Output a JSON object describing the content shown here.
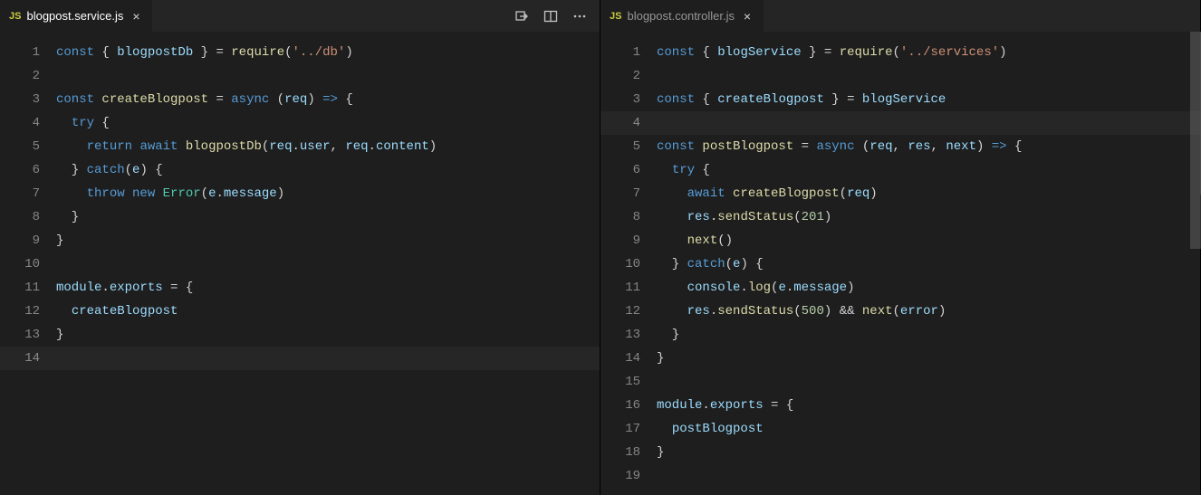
{
  "leftPane": {
    "tab": {
      "icon": "JS",
      "title": "blogpost.service.js",
      "active": true
    },
    "activeLine": 14,
    "lines": [
      {
        "n": 1,
        "tokens": [
          [
            "kw",
            "const"
          ],
          [
            "pun",
            " { "
          ],
          [
            "var",
            "blogpostDb"
          ],
          [
            "pun",
            " } "
          ],
          [
            "op",
            "="
          ],
          [
            "pun",
            " "
          ],
          [
            "fn",
            "require"
          ],
          [
            "pun",
            "("
          ],
          [
            "str",
            "'../db'"
          ],
          [
            "pun",
            ")"
          ]
        ]
      },
      {
        "n": 2,
        "tokens": []
      },
      {
        "n": 3,
        "tokens": [
          [
            "kw",
            "const"
          ],
          [
            "pun",
            " "
          ],
          [
            "fn",
            "createBlogpost"
          ],
          [
            "pun",
            " "
          ],
          [
            "op",
            "="
          ],
          [
            "pun",
            " "
          ],
          [
            "kw",
            "async"
          ],
          [
            "pun",
            " ("
          ],
          [
            "var",
            "req"
          ],
          [
            "pun",
            ") "
          ],
          [
            "arrow",
            "=>"
          ],
          [
            "pun",
            " {"
          ]
        ]
      },
      {
        "n": 4,
        "tokens": [
          [
            "pun",
            "  "
          ],
          [
            "kw",
            "try"
          ],
          [
            "pun",
            " {"
          ]
        ]
      },
      {
        "n": 5,
        "tokens": [
          [
            "pun",
            "    "
          ],
          [
            "kw",
            "return"
          ],
          [
            "pun",
            " "
          ],
          [
            "kw",
            "await"
          ],
          [
            "pun",
            " "
          ],
          [
            "fn",
            "blogpostDb"
          ],
          [
            "pun",
            "("
          ],
          [
            "var",
            "req"
          ],
          [
            "pun",
            "."
          ],
          [
            "var",
            "user"
          ],
          [
            "pun",
            ", "
          ],
          [
            "var",
            "req"
          ],
          [
            "pun",
            "."
          ],
          [
            "var",
            "content"
          ],
          [
            "pun",
            ")"
          ]
        ]
      },
      {
        "n": 6,
        "tokens": [
          [
            "pun",
            "  } "
          ],
          [
            "kw",
            "catch"
          ],
          [
            "pun",
            "("
          ],
          [
            "var",
            "e"
          ],
          [
            "pun",
            ") {"
          ]
        ]
      },
      {
        "n": 7,
        "tokens": [
          [
            "pun",
            "    "
          ],
          [
            "kw",
            "throw"
          ],
          [
            "pun",
            " "
          ],
          [
            "kw",
            "new"
          ],
          [
            "pun",
            " "
          ],
          [
            "cls",
            "Error"
          ],
          [
            "pun",
            "("
          ],
          [
            "var",
            "e"
          ],
          [
            "pun",
            "."
          ],
          [
            "var",
            "message"
          ],
          [
            "pun",
            ")"
          ]
        ]
      },
      {
        "n": 8,
        "tokens": [
          [
            "pun",
            "  }"
          ]
        ]
      },
      {
        "n": 9,
        "tokens": [
          [
            "pun",
            "}"
          ]
        ]
      },
      {
        "n": 10,
        "tokens": []
      },
      {
        "n": 11,
        "tokens": [
          [
            "var",
            "module"
          ],
          [
            "pun",
            "."
          ],
          [
            "var",
            "exports"
          ],
          [
            "pun",
            " "
          ],
          [
            "op",
            "="
          ],
          [
            "pun",
            " {"
          ]
        ]
      },
      {
        "n": 12,
        "tokens": [
          [
            "pun",
            "  "
          ],
          [
            "var",
            "createBlogpost"
          ]
        ]
      },
      {
        "n": 13,
        "tokens": [
          [
            "pun",
            "}"
          ]
        ]
      },
      {
        "n": 14,
        "tokens": []
      }
    ]
  },
  "rightPane": {
    "tab": {
      "icon": "JS",
      "title": "blogpost.controller.js",
      "active": false
    },
    "activeLine": 4,
    "lines": [
      {
        "n": 1,
        "tokens": [
          [
            "kw",
            "const"
          ],
          [
            "pun",
            " { "
          ],
          [
            "var",
            "blogService"
          ],
          [
            "pun",
            " } "
          ],
          [
            "op",
            "="
          ],
          [
            "pun",
            " "
          ],
          [
            "fn",
            "require"
          ],
          [
            "pun",
            "("
          ],
          [
            "str",
            "'../services'"
          ],
          [
            "pun",
            ")"
          ]
        ]
      },
      {
        "n": 2,
        "tokens": []
      },
      {
        "n": 3,
        "tokens": [
          [
            "kw",
            "const"
          ],
          [
            "pun",
            " { "
          ],
          [
            "var",
            "createBlogpost"
          ],
          [
            "pun",
            " } "
          ],
          [
            "op",
            "="
          ],
          [
            "pun",
            " "
          ],
          [
            "var",
            "blogService"
          ]
        ]
      },
      {
        "n": 4,
        "tokens": []
      },
      {
        "n": 5,
        "tokens": [
          [
            "kw",
            "const"
          ],
          [
            "pun",
            " "
          ],
          [
            "fn",
            "postBlogpost"
          ],
          [
            "pun",
            " "
          ],
          [
            "op",
            "="
          ],
          [
            "pun",
            " "
          ],
          [
            "kw",
            "async"
          ],
          [
            "pun",
            " ("
          ],
          [
            "var",
            "req"
          ],
          [
            "pun",
            ", "
          ],
          [
            "var",
            "res"
          ],
          [
            "pun",
            ", "
          ],
          [
            "var",
            "next"
          ],
          [
            "pun",
            ") "
          ],
          [
            "arrow",
            "=>"
          ],
          [
            "pun",
            " {"
          ]
        ]
      },
      {
        "n": 6,
        "tokens": [
          [
            "pun",
            "  "
          ],
          [
            "kw",
            "try"
          ],
          [
            "pun",
            " {"
          ]
        ]
      },
      {
        "n": 7,
        "tokens": [
          [
            "pun",
            "    "
          ],
          [
            "kw",
            "await"
          ],
          [
            "pun",
            " "
          ],
          [
            "fn",
            "createBlogpost"
          ],
          [
            "pun",
            "("
          ],
          [
            "var",
            "req"
          ],
          [
            "pun",
            ")"
          ]
        ]
      },
      {
        "n": 8,
        "tokens": [
          [
            "pun",
            "    "
          ],
          [
            "var",
            "res"
          ],
          [
            "pun",
            "."
          ],
          [
            "fn",
            "sendStatus"
          ],
          [
            "pun",
            "("
          ],
          [
            "num",
            "201"
          ],
          [
            "pun",
            ")"
          ]
        ]
      },
      {
        "n": 9,
        "tokens": [
          [
            "pun",
            "    "
          ],
          [
            "fn",
            "next"
          ],
          [
            "pun",
            "()"
          ]
        ]
      },
      {
        "n": 10,
        "tokens": [
          [
            "pun",
            "  } "
          ],
          [
            "kw",
            "catch"
          ],
          [
            "pun",
            "("
          ],
          [
            "var",
            "e"
          ],
          [
            "pun",
            ") {"
          ]
        ]
      },
      {
        "n": 11,
        "tokens": [
          [
            "pun",
            "    "
          ],
          [
            "var",
            "console"
          ],
          [
            "pun",
            "."
          ],
          [
            "fn",
            "log"
          ],
          [
            "pun",
            "("
          ],
          [
            "var",
            "e"
          ],
          [
            "pun",
            "."
          ],
          [
            "var",
            "message"
          ],
          [
            "pun",
            ")"
          ]
        ]
      },
      {
        "n": 12,
        "tokens": [
          [
            "pun",
            "    "
          ],
          [
            "var",
            "res"
          ],
          [
            "pun",
            "."
          ],
          [
            "fn",
            "sendStatus"
          ],
          [
            "pun",
            "("
          ],
          [
            "num",
            "500"
          ],
          [
            "pun",
            ") "
          ],
          [
            "op",
            "&&"
          ],
          [
            "pun",
            " "
          ],
          [
            "fn",
            "next"
          ],
          [
            "pun",
            "("
          ],
          [
            "var",
            "error"
          ],
          [
            "pun",
            ")"
          ]
        ]
      },
      {
        "n": 13,
        "tokens": [
          [
            "pun",
            "  }"
          ]
        ]
      },
      {
        "n": 14,
        "tokens": [
          [
            "pun",
            "}"
          ]
        ]
      },
      {
        "n": 15,
        "tokens": []
      },
      {
        "n": 16,
        "tokens": [
          [
            "var",
            "module"
          ],
          [
            "pun",
            "."
          ],
          [
            "var",
            "exports"
          ],
          [
            "pun",
            " "
          ],
          [
            "op",
            "="
          ],
          [
            "pun",
            " {"
          ]
        ]
      },
      {
        "n": 17,
        "tokens": [
          [
            "pun",
            "  "
          ],
          [
            "var",
            "postBlogpost"
          ]
        ]
      },
      {
        "n": 18,
        "tokens": [
          [
            "pun",
            "}"
          ]
        ]
      },
      {
        "n": 19,
        "tokens": []
      }
    ]
  }
}
